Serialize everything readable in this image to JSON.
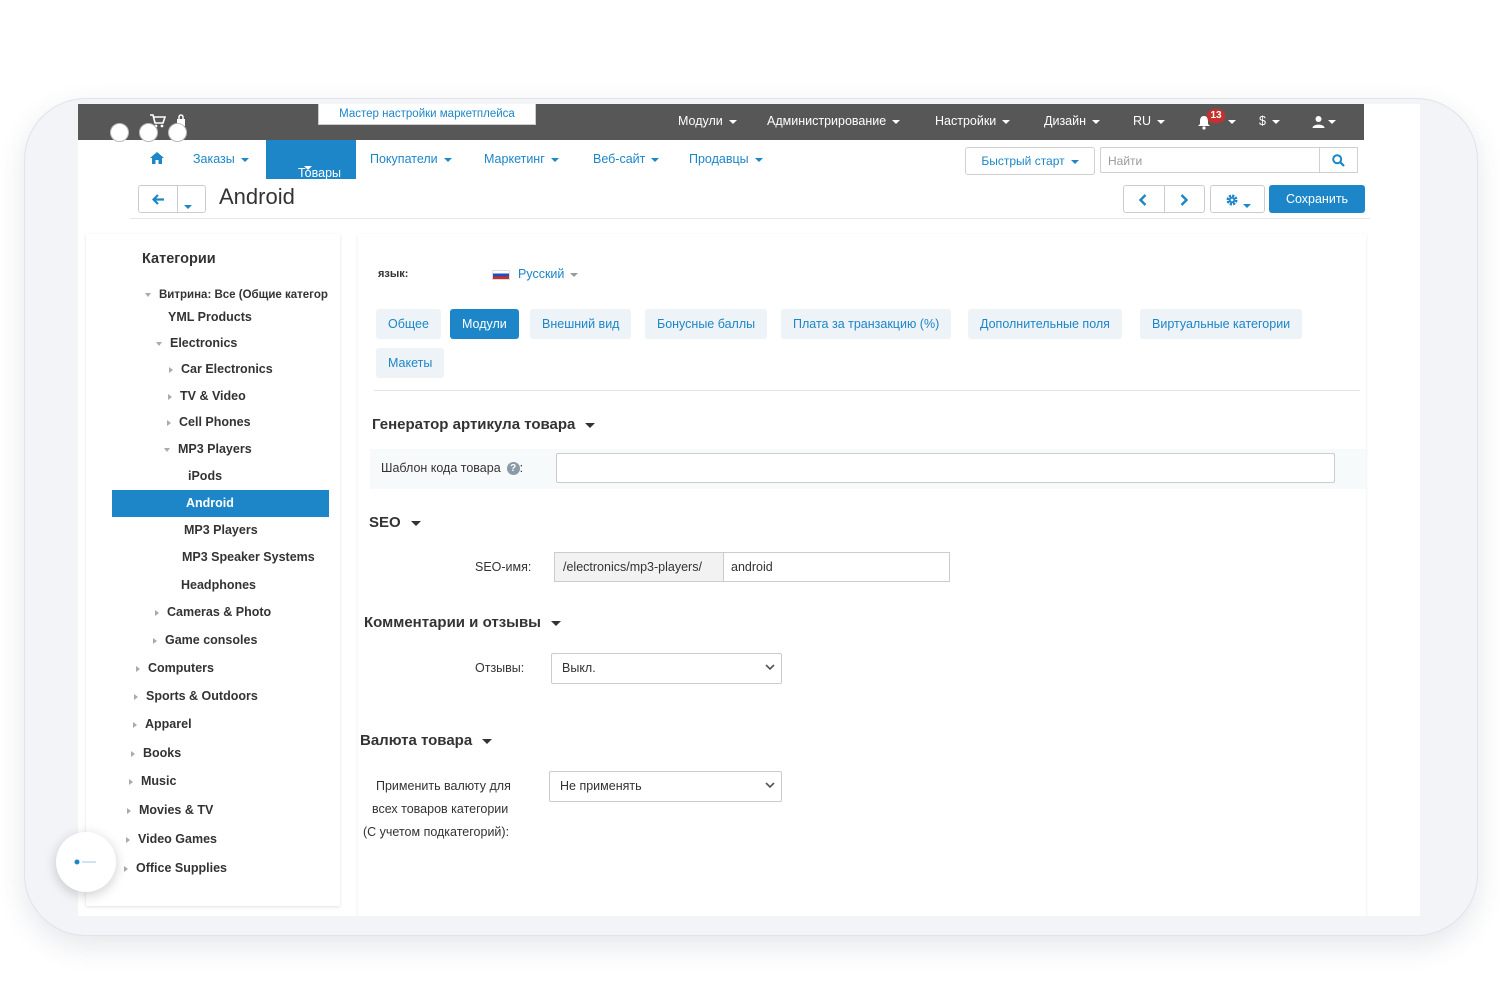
{
  "topbar": {
    "wizard_label": "Мастер настройки маркетплейса",
    "menus": [
      "Модули",
      "Администрирование",
      "Настройки",
      "Дизайн",
      "RU",
      "$"
    ],
    "notifications_count": "13"
  },
  "nav": {
    "items": [
      "Заказы",
      "Товары",
      "Покупатели",
      "Маркетинг",
      "Веб-сайт",
      "Продавцы"
    ],
    "active": "Товары",
    "quick_start": "Быстрый старт",
    "search_placeholder": "Найти"
  },
  "title_bar": {
    "page_title": "Android",
    "save_label": "Сохранить"
  },
  "sidebar": {
    "heading": "Категории",
    "storefront": "Витрина: Все (Общие категор",
    "items": [
      "YML Products",
      "Electronics",
      "Car Electronics",
      "TV & Video",
      "Cell Phones",
      "MP3 Players",
      "iPods",
      "Android",
      "MP3 Players",
      "MP3 Speaker Systems",
      "Headphones",
      "Cameras & Photo",
      "Game consoles",
      "Computers",
      "Sports & Outdoors",
      "Apparel",
      "Books",
      "Music",
      "Movies & TV",
      "Video Games",
      "Office Supplies"
    ],
    "active_item": "Android"
  },
  "main": {
    "lang_label": "язык:",
    "lang_value": "Русский",
    "tabs": [
      "Общее",
      "Модули",
      "Внешний вид",
      "Бонусные баллы",
      "Плата за транзакцию (%)",
      "Дополнительные поля",
      "Виртуальные категории",
      "Макеты"
    ],
    "active_tab": "Модули",
    "sections": {
      "generator": {
        "heading": "Генератор артикула товара",
        "field_label": "Шаблон кода товара",
        "field_value": ""
      },
      "seo": {
        "heading": "SEO",
        "field_label": "SEO-имя:",
        "prefix": "/electronics/mp3-players/",
        "value": "android"
      },
      "comments": {
        "heading": "Комментарии и отзывы",
        "field_label": "Отзывы:",
        "value": "Выкл."
      },
      "currency": {
        "heading": "Валюта товара",
        "field_label_lines": [
          "Применить валюту для",
          "всех товаров категории",
          "(С учетом подкатегорий):"
        ],
        "value": "Не применять"
      }
    }
  },
  "colors": {
    "accent": "#1c86c8",
    "topbar": "#575757",
    "badge": "#c9302c"
  }
}
